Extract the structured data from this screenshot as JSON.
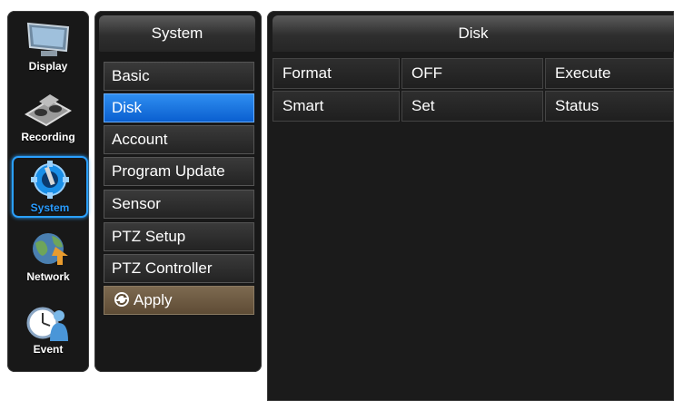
{
  "nav": {
    "display_label": "Display",
    "recording_label": "Recording",
    "system_label": "System",
    "network_label": "Network",
    "event_label": "Event",
    "active": "System"
  },
  "menu": {
    "title": "System",
    "items": [
      "Basic",
      "Disk",
      "Account",
      "Program Update",
      "Sensor",
      "PTZ Setup",
      "PTZ Controller"
    ],
    "selected": "Disk",
    "apply_label": "Apply"
  },
  "content": {
    "title": "Disk",
    "rows": [
      [
        "Format",
        "OFF",
        "Execute"
      ],
      [
        "Smart",
        "Set",
        "Status"
      ]
    ]
  },
  "colors": {
    "accent": "#0a6ee0",
    "active_outline": "#2aa0ff",
    "apply": "#6e5b42",
    "panel": "#181818"
  }
}
